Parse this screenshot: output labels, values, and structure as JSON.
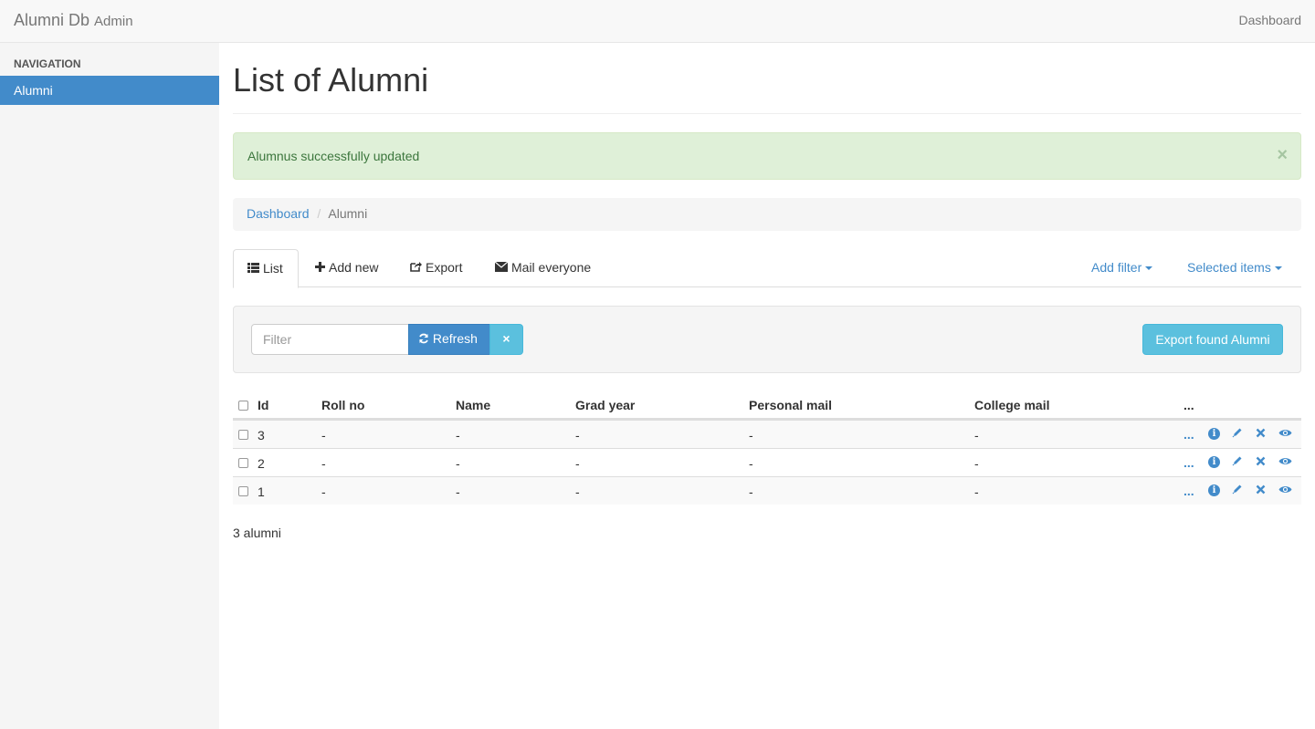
{
  "topbar": {
    "brand": "Alumni Db",
    "brand_sub": "Admin",
    "link": "Dashboard"
  },
  "sidebar": {
    "header": "Navigation",
    "items": [
      {
        "label": "Alumni",
        "active": true
      }
    ]
  },
  "page": {
    "title": "List of Alumni"
  },
  "alert": {
    "message": "Alumnus successfully updated",
    "close": "×"
  },
  "breadcrumb": {
    "link": "Dashboard",
    "separator": "/",
    "current": "Alumni"
  },
  "tabs": {
    "list": "List",
    "add_new": "Add new",
    "export": "Export",
    "mail": "Mail everyone",
    "add_filter": "Add filter",
    "selected_items": "Selected items"
  },
  "filter": {
    "placeholder": "Filter",
    "refresh": "Refresh",
    "clear": "×",
    "export_found": "Export found Alumni"
  },
  "table": {
    "columns": [
      "Id",
      "Roll no",
      "Name",
      "Grad year",
      "Personal mail",
      "College mail",
      "..."
    ],
    "rows": [
      {
        "id": "3",
        "roll_no": "-",
        "name": "-",
        "grad_year": "-",
        "personal_mail": "-",
        "college_mail": "-"
      },
      {
        "id": "2",
        "roll_no": "-",
        "name": "-",
        "grad_year": "-",
        "personal_mail": "-",
        "college_mail": "-"
      },
      {
        "id": "1",
        "roll_no": "-",
        "name": "-",
        "grad_year": "-",
        "personal_mail": "-",
        "college_mail": "-"
      }
    ],
    "action_more": "...",
    "icons": [
      "info-icon",
      "pencil-icon",
      "delete-icon",
      "eye-icon"
    ]
  },
  "footer": {
    "count": "3 alumni"
  },
  "colors": {
    "primary": "#428bca",
    "info": "#5bc0de",
    "success_bg": "#dff0d8",
    "success_text": "#3c763d"
  }
}
